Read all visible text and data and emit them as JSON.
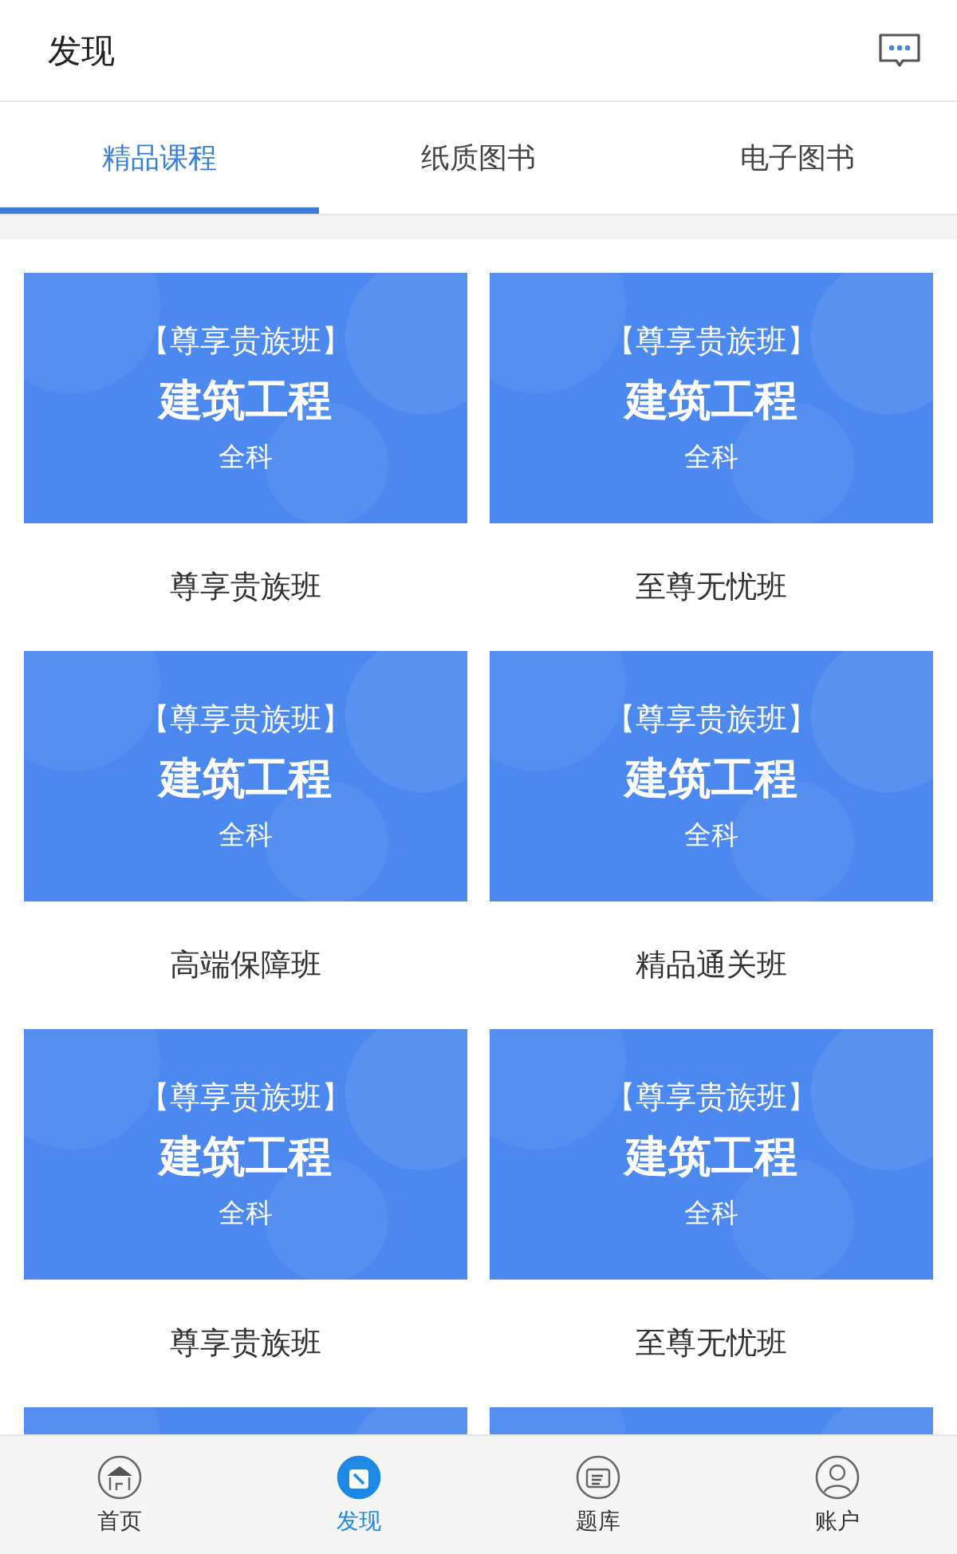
{
  "header": {
    "title": "发现"
  },
  "tabs": [
    {
      "label": "精品课程",
      "selected": true
    },
    {
      "label": "纸质图书",
      "selected": false
    },
    {
      "label": "电子图书",
      "selected": false
    }
  ],
  "courses": [
    {
      "banner_tag": "【尊享贵族班】",
      "banner_title": "建筑工程",
      "banner_subtitle": "全科",
      "name": "尊享贵族班"
    },
    {
      "banner_tag": "【尊享贵族班】",
      "banner_title": "建筑工程",
      "banner_subtitle": "全科",
      "name": "至尊无忧班"
    },
    {
      "banner_tag": "【尊享贵族班】",
      "banner_title": "建筑工程",
      "banner_subtitle": "全科",
      "name": "高端保障班"
    },
    {
      "banner_tag": "【尊享贵族班】",
      "banner_title": "建筑工程",
      "banner_subtitle": "全科",
      "name": "精品通关班"
    },
    {
      "banner_tag": "【尊享贵族班】",
      "banner_title": "建筑工程",
      "banner_subtitle": "全科",
      "name": "尊享贵族班"
    },
    {
      "banner_tag": "【尊享贵族班】",
      "banner_title": "建筑工程",
      "banner_subtitle": "全科",
      "name": "至尊无忧班"
    }
  ],
  "peek_cards": [
    {
      "kind": "banner"
    },
    {
      "kind": "banner"
    }
  ],
  "bottom_nav": [
    {
      "label": "首页",
      "selected": false
    },
    {
      "label": "发现",
      "selected": true
    },
    {
      "label": "题库",
      "selected": false
    },
    {
      "label": "账户",
      "selected": false
    }
  ]
}
